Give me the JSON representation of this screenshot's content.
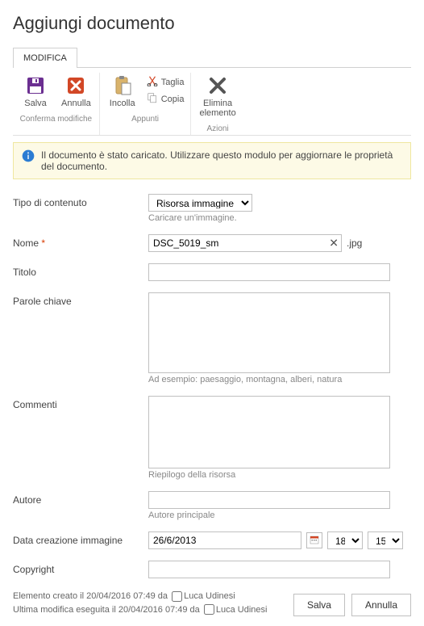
{
  "page_title": "Aggiungi documento",
  "tabs": {
    "edit": "MODIFICA"
  },
  "ribbon": {
    "group_commit": {
      "label": "Conferma modifiche",
      "save": "Salva",
      "cancel": "Annulla"
    },
    "group_clipboard": {
      "label": "Appunti",
      "paste": "Incolla",
      "cut": "Taglia",
      "copy": "Copia"
    },
    "group_actions": {
      "label": "Azioni",
      "delete_line1": "Elimina",
      "delete_line2": "elemento"
    }
  },
  "notice": "Il documento è stato caricato. Utilizzare questo modulo per aggiornare le proprietà del documento.",
  "form": {
    "content_type": {
      "label": "Tipo di contenuto",
      "value": "Risorsa immagine",
      "hint": "Caricare un'immagine."
    },
    "name": {
      "label": "Nome",
      "value": "DSC_5019_sm",
      "ext": ".jpg"
    },
    "title": {
      "label": "Titolo",
      "value": ""
    },
    "keywords": {
      "label": "Parole chiave",
      "value": "",
      "hint": "Ad esempio: paesaggio, montagna, alberi, natura"
    },
    "comments": {
      "label": "Commenti",
      "value": "",
      "hint": "Riepilogo della risorsa"
    },
    "author": {
      "label": "Autore",
      "value": "",
      "hint": "Autore principale"
    },
    "img_date": {
      "label": "Data creazione immagine",
      "date": "26/6/2013",
      "hour": "18:",
      "minute": "15"
    },
    "copyright": {
      "label": "Copyright",
      "value": ""
    }
  },
  "meta": {
    "created_prefix": "Elemento creato il ",
    "created_date": "20/04/2016 07:49",
    "by": " da ",
    "created_user": "Luca Udinesi",
    "modified_prefix": "Ultima modifica eseguita il ",
    "modified_date": "20/04/2016 07:49",
    "modified_user": "Luca Udinesi"
  },
  "buttons": {
    "save": "Salva",
    "cancel": "Annulla"
  }
}
